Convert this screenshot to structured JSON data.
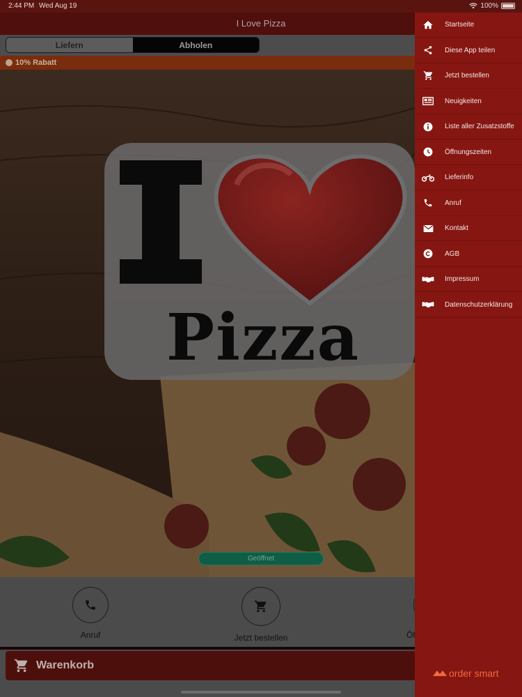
{
  "status_bar": {
    "time": "2:44 PM",
    "date": "Wed Aug 19",
    "battery": "100%"
  },
  "nav": {
    "title": "I Love Pizza"
  },
  "segment": {
    "left": "Liefern",
    "right": "Abholen"
  },
  "discount": {
    "label": "10% Rabatt"
  },
  "hero": {
    "logo_line1": "I",
    "logo_line2": "Pizza"
  },
  "status_badge": "Geöffnet",
  "quick_actions": [
    {
      "label": "Anruf",
      "icon": "phone-icon"
    },
    {
      "label": "Jetzt bestellen",
      "icon": "cart-icon"
    },
    {
      "label": "Öf",
      "icon": "clock-icon"
    }
  ],
  "cart": {
    "label": "Warenkorb"
  },
  "menu": {
    "items": [
      {
        "label": "Startseite",
        "icon": "home-icon"
      },
      {
        "label": "Diese App teilen",
        "icon": "share-icon"
      },
      {
        "label": "Jetzt bestellen",
        "icon": "cart-icon"
      },
      {
        "label": "Neuigkeiten",
        "icon": "newspaper-icon"
      },
      {
        "label": "Liste aller Zusatzstoffe",
        "icon": "info-icon"
      },
      {
        "label": "Öffnungszeiten",
        "icon": "clock-icon"
      },
      {
        "label": "Lieferinfo",
        "icon": "motorcycle-icon"
      },
      {
        "label": "Anruf",
        "icon": "phone-icon"
      },
      {
        "label": "Kontakt",
        "icon": "mail-icon"
      },
      {
        "label": "AGB",
        "icon": "copyright-icon"
      },
      {
        "label": "Impressum",
        "icon": "handshake-icon"
      },
      {
        "label": "Datenschutzerklärung",
        "icon": "handshake-icon"
      }
    ],
    "brand": "order smart"
  },
  "colors": {
    "menu_bg": "#861611",
    "nav_bg": "#4f0f0c",
    "badge_green": "#0e5d44",
    "brand_orange": "#ee6a3f"
  }
}
